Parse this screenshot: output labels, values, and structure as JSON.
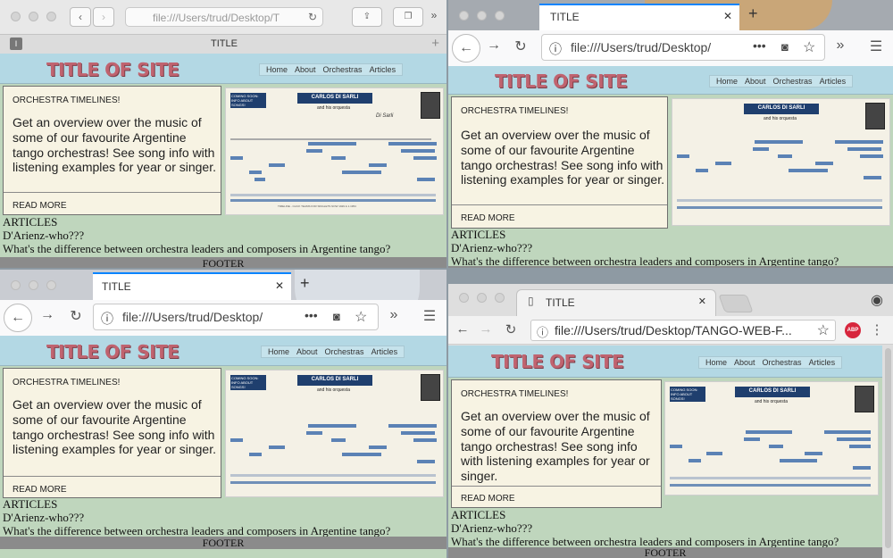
{
  "site": {
    "logo": "TITLE OF SITE",
    "nav": [
      "Home",
      "About",
      "Orchestras",
      "Articles"
    ],
    "card_title": "ORCHESTRA TIMELINES!",
    "card_body": "Get an overview over the music of some of our favourite Argentine tango orchestras! See song info with listening examples for year or singer.",
    "read_more": "READ MORE",
    "articles_heading": "ARTICLES",
    "article_1": "D'Arienz-who???",
    "article_2": "What's the difference between orchestra leaders and composers in Argentine tango?",
    "footer": "FOOTER",
    "poster": {
      "title": "CARLOS DI SARLI",
      "subtitle": "and his orquesta",
      "label": "COMING SOON: INFO ABOUT SONGS!",
      "signature": "Di Sarli",
      "bottom": "TIMELINE - CLICK TEAMS FOR SINGLETS NOW 1929 & 1.1954"
    }
  },
  "safari": {
    "tab_title": "TITLE",
    "url": "file:///Users/trud/Desktop/T"
  },
  "firefox_tr": {
    "tab_title": "TITLE",
    "url": "file:///Users/trud/Desktop/"
  },
  "firefox_bl": {
    "tab_title": "TITLE",
    "url": "file:///Users/trud/Desktop/"
  },
  "chrome": {
    "tab_title": "TITLE",
    "url": "file:///Users/trud/Desktop/TANGO-WEB-F...",
    "abp": "ABP"
  },
  "icons": [
    "back-icon",
    "forward-icon",
    "reload-icon",
    "share-icon",
    "tabs-icon",
    "overflow-icon",
    "info-icon",
    "star-icon",
    "pocket-icon",
    "menu-icon",
    "close-icon",
    "plus-icon",
    "user-icon",
    "kebab-icon"
  ]
}
